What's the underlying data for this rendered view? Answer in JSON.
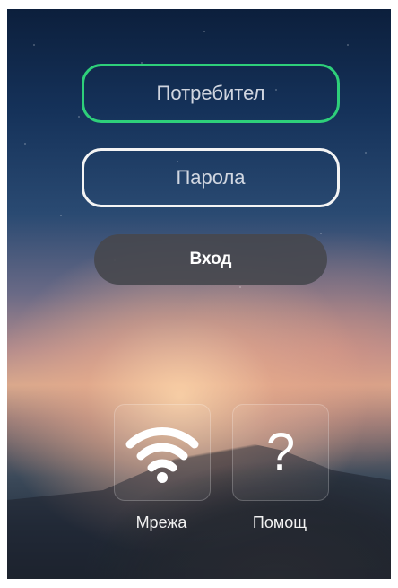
{
  "login_form": {
    "username_placeholder": "Потребител",
    "password_placeholder": "Парола",
    "login_label": "Вход"
  },
  "quick_actions": [
    {
      "label": "Мрежа",
      "icon": "wifi-icon"
    },
    {
      "label": "Помощ",
      "icon": "question-mark-icon",
      "glyph": "?"
    }
  ],
  "colors": {
    "username_border": "#2ecf7a",
    "password_border": "#f4f4f4",
    "login_button": "#46484e"
  }
}
